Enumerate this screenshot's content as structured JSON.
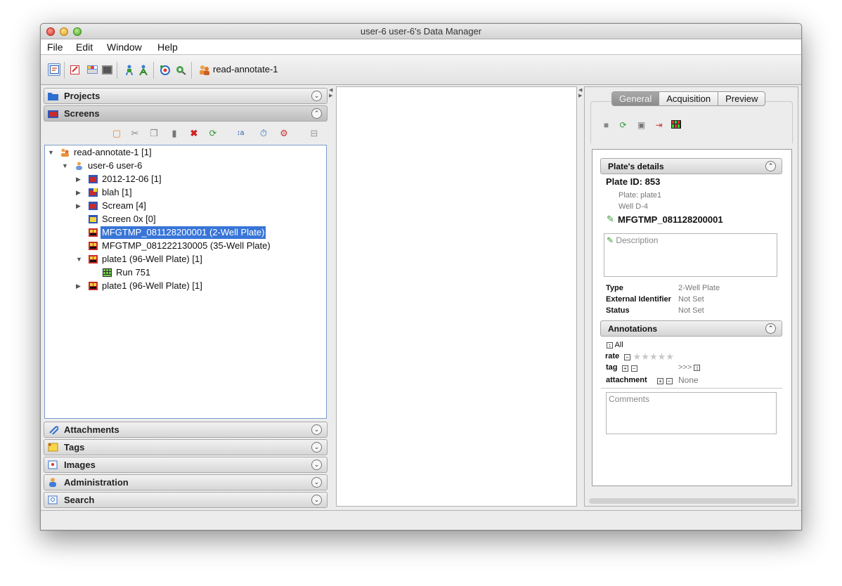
{
  "window": {
    "title": "user-6 user-6's Data Manager"
  },
  "menu": [
    "File",
    "Edit",
    "Window",
    "Help"
  ],
  "toolbar": {
    "group_label": "read-annotate-1"
  },
  "left": {
    "projects": "Projects",
    "screens": "Screens",
    "attachments": "Attachments",
    "tags": "Tags",
    "images": "Images",
    "administration": "Administration",
    "search": "Search"
  },
  "tree": [
    {
      "label": "read-annotate-1 [1]"
    },
    {
      "label": "user-6 user-6"
    },
    {
      "label": "2012-12-06 [1]"
    },
    {
      "label": "blah [1]"
    },
    {
      "label": "Scream [4]"
    },
    {
      "label": "Screen 0x [0]"
    },
    {
      "label": "MFGTMP_081128200001 (2-Well Plate)"
    },
    {
      "label": "MFGTMP_081222130005 (35-Well Plate)"
    },
    {
      "label": "plate1 (96-Well Plate) [1]"
    },
    {
      "label": "Run 751"
    },
    {
      "label": "plate1 (96-Well Plate) [1]"
    }
  ],
  "right": {
    "tabs": [
      "General",
      "Acquisition",
      "Preview"
    ],
    "details_header": "Plate's details",
    "plate_id": "Plate ID: 853",
    "plate_name": "Plate: plate1",
    "well": "Well D-4",
    "name": "MFGTMP_081128200001",
    "description_placeholder": "Description",
    "type_label": "Type",
    "type_value": "2-Well Plate",
    "ext_label": "External Identifier",
    "ext_value": "Not Set",
    "status_label": "Status",
    "status_value": "Not Set",
    "annotations_header": "Annotations",
    "all_label": "All",
    "rate_label": "rate",
    "tag_label": "tag",
    "tag_more": ">>>",
    "attachment_label": "attachment",
    "attachment_value": "None",
    "comments_placeholder": "Comments"
  }
}
